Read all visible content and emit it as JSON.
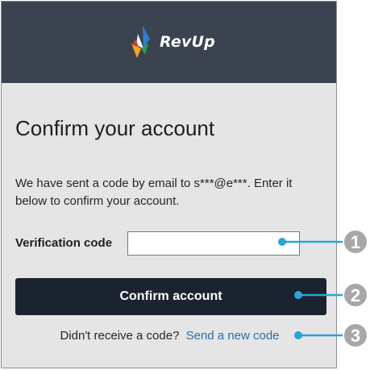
{
  "brand": {
    "name": "RevUp",
    "logo_icon": "revup-logo-icon",
    "header_color": "#3b4350"
  },
  "page": {
    "title": "Confirm your account",
    "message": "We have sent a code by email to s***@e***. Enter it below to confirm your account."
  },
  "form": {
    "verification_label": "Verification code",
    "verification_value": "",
    "confirm_label": "Confirm account",
    "confirm_color": "#1c2330",
    "resend_prompt": "Didn't receive a code?",
    "resend_link": "Send a new code",
    "link_color": "#2f6ea8"
  },
  "callouts": {
    "color": "#2aa3d6",
    "badge_color": "#a7a7a7",
    "items": [
      "1",
      "2",
      "3"
    ]
  }
}
